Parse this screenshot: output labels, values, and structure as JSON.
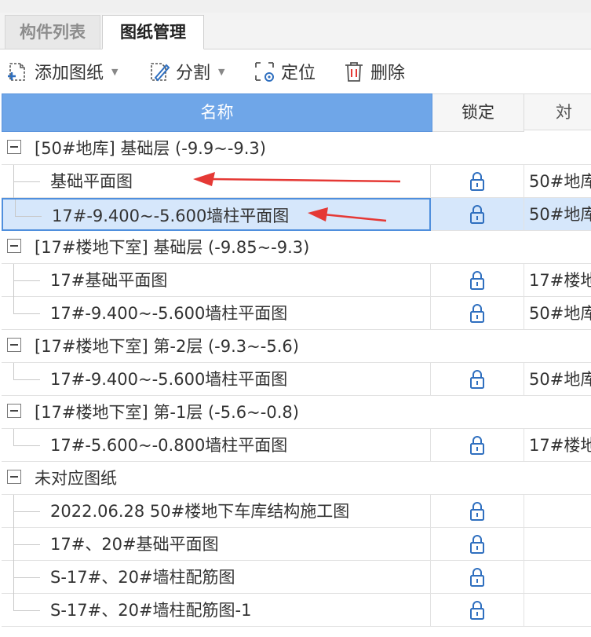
{
  "tabs": [
    {
      "label": "构件列表",
      "active": false
    },
    {
      "label": "图纸管理",
      "active": true
    }
  ],
  "toolbar": {
    "add_label": "添加图纸",
    "split_label": "分割",
    "locate_label": "定位",
    "delete_label": "删除"
  },
  "table": {
    "headers": {
      "name": "名称",
      "lock": "锁定",
      "ref": "対"
    }
  },
  "groups": [
    {
      "label": "[50#地库] 基础层 (-9.9~-9.3)",
      "items": [
        {
          "name": "基础平面图",
          "ref": "50#地库"
        },
        {
          "name": "17#-9.400~-5.600墙柱平面图",
          "ref": "50#地库",
          "selected": true
        }
      ]
    },
    {
      "label": "[17#楼地下室] 基础层 (-9.85~-9.3)",
      "items": [
        {
          "name": "17#基础平面图",
          "ref": "17#楼地"
        },
        {
          "name": "17#-9.400~-5.600墙柱平面图",
          "ref": "50#地库"
        }
      ]
    },
    {
      "label": "[17#楼地下室] 第-2层 (-9.3~-5.6)",
      "items": [
        {
          "name": "17#-9.400~-5.600墙柱平面图",
          "ref": "50#地库"
        }
      ]
    },
    {
      "label": "[17#楼地下室] 第-1层 (-5.6~-0.8)",
      "items": [
        {
          "name": "17#-5.600~-0.800墙柱平面图",
          "ref": "17#楼地"
        }
      ]
    },
    {
      "label": "未对应图纸",
      "items": [
        {
          "name": "2022.06.28 50#楼地下车库结构施工图",
          "ref": ""
        },
        {
          "name": "17#、20#基础平面图",
          "ref": ""
        },
        {
          "name": "S-17#、20#墙柱配筋图",
          "ref": ""
        },
        {
          "name": "S-17#、20#墙柱配筋图-1",
          "ref": ""
        }
      ]
    }
  ],
  "colors": {
    "header_blue": "#6fa6e8",
    "selection": "#d6e7fb",
    "lock_blue": "#2f6fbf",
    "arrow_red": "#e53935"
  },
  "icons": {
    "add": "add-drawing-icon",
    "split": "split-icon",
    "locate": "locate-icon",
    "delete": "trash-icon",
    "lock": "lock-icon",
    "expander": "collapse-minus-icon"
  }
}
